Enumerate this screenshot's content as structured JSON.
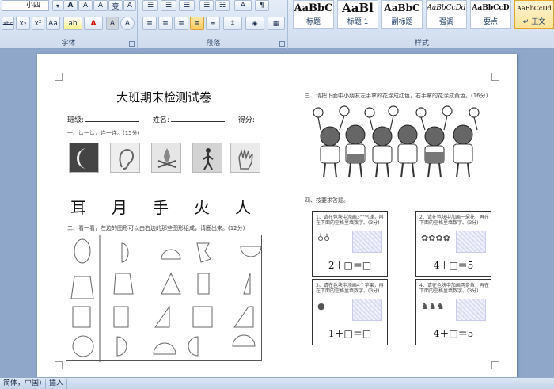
{
  "ribbon": {
    "font_size_value": "小四",
    "font_group_label": "字体",
    "paragraph_group_label": "段落",
    "styles_group_label": "样式",
    "font_buttons_row1": [
      "A",
      "A",
      "A",
      "变",
      "A"
    ],
    "font_buttons_row2": [
      "abc",
      "x₂",
      "x²",
      "Aa",
      "ab",
      "A",
      "A",
      "A"
    ],
    "para_buttons_row1": [
      "☰",
      "☰",
      "☰",
      "☰",
      "☵",
      "A",
      "¶"
    ],
    "para_buttons_row2": [
      "≡",
      "≡",
      "≡",
      "≡",
      "≣",
      "↕",
      "◈",
      "▦"
    ],
    "styles": [
      {
        "preview": "AaBbC",
        "name": "标题"
      },
      {
        "preview": "AaBl",
        "name": "标题 1"
      },
      {
        "preview": "AaBbC",
        "name": "副标题"
      },
      {
        "preview": "AaBbCcDd",
        "name": "强调"
      },
      {
        "preview": "AaBbCcD",
        "name": "要点"
      },
      {
        "preview": "AaBbCcDd",
        "name": "↵ 正文"
      }
    ],
    "colors": {
      "accent_active": "#ffc95e",
      "ribbon_bg": "#cfdcee"
    }
  },
  "document": {
    "title": "大班期末检测试卷",
    "class_label": "班级:",
    "name_label": "姓名:",
    "score_label": "得分:",
    "q1_text": "一、认一认，连一连。(15分)",
    "big_chars": [
      "耳",
      "月",
      "手",
      "火",
      "人"
    ],
    "q2_text": "二、看一看，左边的图形可以由右边的那些图形组成，请圈出来。(12分)",
    "q3_text": "三、请把下面中小朋友左手拿的花涂成红色，右手拿的花涂成黄色。(16分)",
    "q4_text": "四、按要求答题。",
    "tasks": [
      {
        "desc": "1、请在色块中添画3个气球，再在下面的空格里填数字。(3分)",
        "icons": "♁♁",
        "equation": "2＋□＝□"
      },
      {
        "desc": "2、请在色块中加画一朵花，再在下面的空格里填数字。(3分)",
        "icons": "✿✿✿✿",
        "equation": "4＋□＝5"
      },
      {
        "desc": "3、请在色块中添画4个苹果，再在下面的空格里填数字。(3分)",
        "icons": "●",
        "equation": "1＋□＝□"
      },
      {
        "desc": "4、请在色块中加画两条鱼，再在下面的空格里填数字。(3分)",
        "icons": "♞♞♞",
        "equation": "4＋□＝5"
      }
    ]
  },
  "status_bar": {
    "language": "简体，中国)",
    "mode": "插入"
  }
}
